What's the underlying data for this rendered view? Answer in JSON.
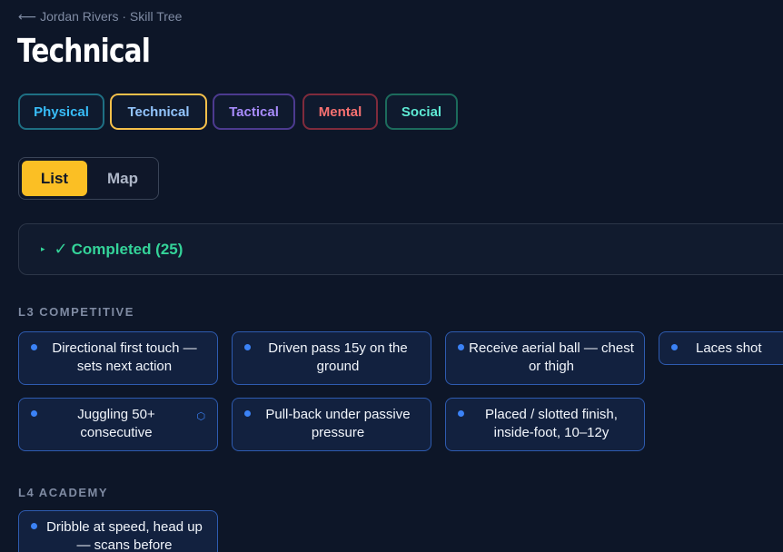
{
  "header": {
    "back_arrow": "⟵",
    "breadcrumb": "Jordan Rivers · Skill Tree",
    "title": "Technical"
  },
  "category_tabs": [
    {
      "label": "Physical",
      "color": "#38bdf8",
      "border": "#1e6f83"
    },
    {
      "label": "Technical",
      "color": "#93c5fd",
      "border": "#f5c04a"
    },
    {
      "label": "Tactical",
      "color": "#a78bfa",
      "border": "#4c3a8f"
    },
    {
      "label": "Mental",
      "color": "#f87171",
      "border": "#7f2b3c"
    },
    {
      "label": "Social",
      "color": "#5eead4",
      "border": "#1c6b5c"
    }
  ],
  "view_toggle": {
    "list_label": "List",
    "map_label": "Map",
    "selected": "List"
  },
  "completed": {
    "caret": "▸",
    "check": "✓",
    "label": "Completed (25)"
  },
  "sections": [
    {
      "heading": "L3 COMPETITIVE",
      "skills": [
        {
          "text": "Directional first touch — sets next action"
        },
        {
          "text": "Driven pass 15y on the ground"
        },
        {
          "text": "Receive aerial ball — chest or thigh"
        },
        {
          "text": "Laces shot"
        },
        {
          "text": "Juggling 50+ consecutive",
          "badge": "⬡"
        },
        {
          "text": "Pull-back under passive pressure"
        },
        {
          "text": "Placed / slotted finish, inside-foot, 10–12y"
        }
      ]
    },
    {
      "heading": "L4 ACADEMY",
      "skills": [
        {
          "text": "Dribble at speed, head up — scans before"
        }
      ]
    }
  ]
}
